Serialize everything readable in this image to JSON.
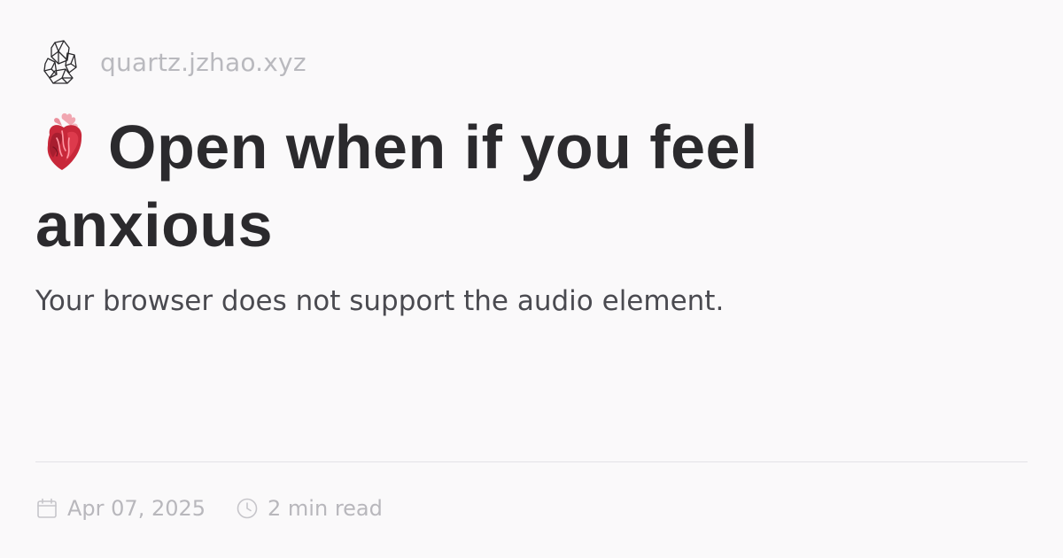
{
  "site": {
    "url": "quartz.jzhao.xyz",
    "logo_icon": "crystal-logo-icon"
  },
  "article": {
    "title_emoji_icon": "anatomical-heart-icon",
    "title": "Open when if you feel anxious",
    "description": "Your browser does not support the audio element."
  },
  "meta": {
    "date_icon": "calendar-icon",
    "date": "Apr 07, 2025",
    "reading_time_icon": "clock-icon",
    "reading_time": "2 min read"
  },
  "colors": {
    "background": "#faf9fa",
    "title_text": "#2b2a2d",
    "body_text": "#4a4a50",
    "muted_text": "#b8b7bc",
    "divider": "#e3e2e6",
    "heart_red": "#c8283a"
  }
}
